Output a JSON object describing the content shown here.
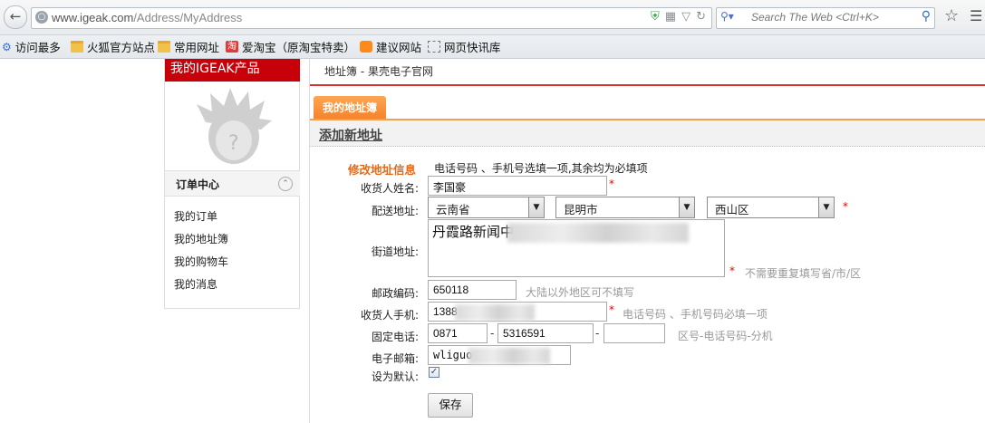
{
  "browser": {
    "url_host": "www.igeak.com",
    "url_path": "/Address/MyAddress",
    "search_placeholder": "Search The Web <Ctrl+K>"
  },
  "bookmarks": [
    {
      "label": "访问最多",
      "icon": "gear-icon"
    },
    {
      "label": "火狐官方站点",
      "icon": "folder-icon"
    },
    {
      "label": "常用网址",
      "icon": "folder-icon"
    },
    {
      "label": "爱淘宝（原淘宝特卖）",
      "icon": "taobao-icon"
    },
    {
      "label": "建议网站",
      "icon": "bulb-icon"
    },
    {
      "label": "网页快讯库",
      "icon": "webslice-icon"
    }
  ],
  "sidebar": {
    "title": "我的IGEAK产品",
    "order_center": "订单中心",
    "links": [
      "我的订单",
      "我的地址簿",
      "我的购物车",
      "我的消息"
    ]
  },
  "page": {
    "breadcrumb": "地址簿 - 果壳电子官网",
    "tab": "我的地址簿",
    "section_title": "添加新地址",
    "info_title": "修改地址信息",
    "info_note": "电话号码 、手机号选填一项,其余均为必填项"
  },
  "form": {
    "labels": {
      "name": "收货人姓名:",
      "region": "配送地址:",
      "street": "街道地址:",
      "postcode": "邮政编码:",
      "mobile": "收货人手机:",
      "phone": "固定电话:",
      "email": "电子邮箱:",
      "default": "设为默认:"
    },
    "name": "李国豪",
    "province": "云南省",
    "city": "昆明市",
    "district": "西山区",
    "street": "丹霞路新闻中",
    "postcode": "650118",
    "mobile": "1388",
    "phone_area": "0871",
    "phone_number": "5316591",
    "phone_ext": "",
    "email": "wliguo",
    "default_checked": "✓",
    "required_mark": "*",
    "dash": "-",
    "hints": {
      "street": "不需要重复填写省/市/区",
      "postcode": "大陆以外地区可不填写",
      "mobile": "电话号码 、手机号码必填一项",
      "phone": "区号-电话号码-分机"
    },
    "save_label": "保存"
  },
  "colors": {
    "brand_red": "#c8000a",
    "tab_orange": "#f4822a",
    "required_red": "#e20000",
    "hint_gray": "#999999"
  }
}
